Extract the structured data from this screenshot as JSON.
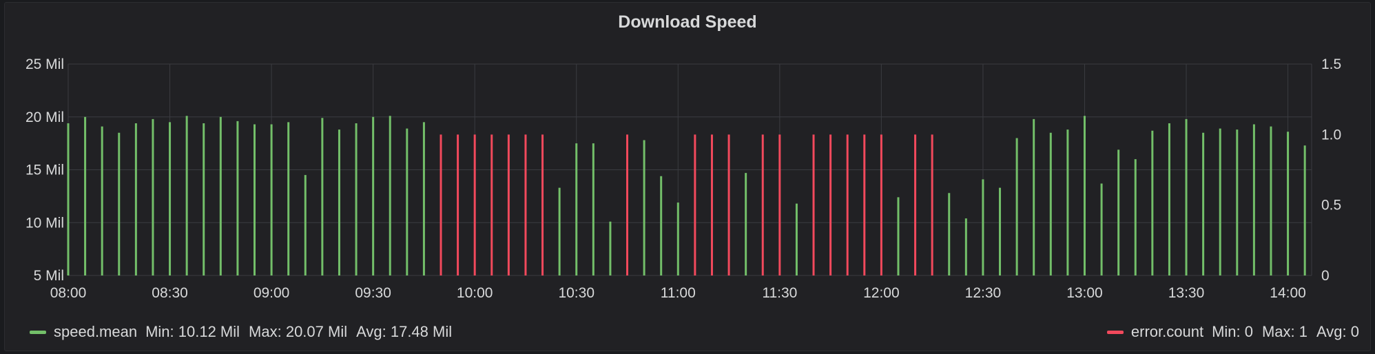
{
  "panel": {
    "title": "Download Speed"
  },
  "chart_data": {
    "type": "bar",
    "title": "Download Speed",
    "x_range": [
      "08:00",
      "14:07"
    ],
    "x_ticks": [
      "08:00",
      "08:30",
      "09:00",
      "09:30",
      "10:00",
      "10:30",
      "11:00",
      "11:30",
      "12:00",
      "12:30",
      "13:00",
      "13:30",
      "14:00"
    ],
    "y_left": {
      "min": 5,
      "max": 25,
      "unit": "Mil",
      "ticks": [
        "5 Mil",
        "10 Mil",
        "15 Mil",
        "20 Mil",
        "25 Mil"
      ]
    },
    "y_right": {
      "min": 0,
      "max": 1.5,
      "ticks": [
        "0",
        "0.5",
        "1.0",
        "1.5"
      ]
    },
    "grid": true,
    "legend_placement": "bottom",
    "series": [
      {
        "name": "speed.mean",
        "axis": "left",
        "color": "#73bf69",
        "points": [
          [
            "08:00",
            19.4
          ],
          [
            "08:05",
            20.0
          ],
          [
            "08:10",
            19.1
          ],
          [
            "08:15",
            18.5
          ],
          [
            "08:20",
            19.4
          ],
          [
            "08:25",
            19.8
          ],
          [
            "08:30",
            19.5
          ],
          [
            "08:35",
            20.1
          ],
          [
            "08:40",
            19.4
          ],
          [
            "08:45",
            20.0
          ],
          [
            "08:50",
            19.6
          ],
          [
            "08:55",
            19.3
          ],
          [
            "09:00",
            19.3
          ],
          [
            "09:05",
            19.5
          ],
          [
            "09:10",
            14.5
          ],
          [
            "09:15",
            19.9
          ],
          [
            "09:20",
            18.8
          ],
          [
            "09:25",
            19.4
          ],
          [
            "09:30",
            20.0
          ],
          [
            "09:35",
            20.1
          ],
          [
            "09:40",
            18.9
          ],
          [
            "09:45",
            19.5
          ],
          [
            "10:25",
            13.3
          ],
          [
            "10:30",
            17.5
          ],
          [
            "10:35",
            17.5
          ],
          [
            "10:40",
            10.1
          ],
          [
            "10:50",
            17.8
          ],
          [
            "10:55",
            14.4
          ],
          [
            "11:00",
            11.9
          ],
          [
            "11:20",
            14.7
          ],
          [
            "11:35",
            11.8
          ],
          [
            "12:05",
            12.4
          ],
          [
            "12:20",
            12.8
          ],
          [
            "12:25",
            10.4
          ],
          [
            "12:30",
            14.1
          ],
          [
            "12:35",
            13.3
          ],
          [
            "12:40",
            18.0
          ],
          [
            "12:45",
            19.8
          ],
          [
            "12:50",
            18.5
          ],
          [
            "12:55",
            18.8
          ],
          [
            "13:00",
            20.1
          ],
          [
            "13:05",
            13.7
          ],
          [
            "13:10",
            16.9
          ],
          [
            "13:15",
            16.0
          ],
          [
            "13:20",
            18.7
          ],
          [
            "13:25",
            19.4
          ],
          [
            "13:30",
            19.8
          ],
          [
            "13:35",
            18.5
          ],
          [
            "13:40",
            18.9
          ],
          [
            "13:45",
            18.8
          ],
          [
            "13:50",
            19.3
          ],
          [
            "13:55",
            19.1
          ],
          [
            "14:00",
            18.6
          ],
          [
            "14:05",
            17.3
          ]
        ]
      },
      {
        "name": "error.count",
        "axis": "right",
        "color": "#f2495c",
        "points": [
          [
            "09:50",
            1
          ],
          [
            "09:55",
            1
          ],
          [
            "10:00",
            1
          ],
          [
            "10:05",
            1
          ],
          [
            "10:10",
            1
          ],
          [
            "10:15",
            1
          ],
          [
            "10:20",
            1
          ],
          [
            "10:45",
            1
          ],
          [
            "11:05",
            1
          ],
          [
            "11:10",
            1
          ],
          [
            "11:15",
            1
          ],
          [
            "11:25",
            1
          ],
          [
            "11:30",
            1
          ],
          [
            "11:40",
            1
          ],
          [
            "11:45",
            1
          ],
          [
            "11:50",
            1
          ],
          [
            "11:55",
            1
          ],
          [
            "12:00",
            1
          ],
          [
            "12:10",
            1
          ],
          [
            "12:15",
            1
          ]
        ]
      }
    ]
  },
  "legend": {
    "left": {
      "name": "speed.mean",
      "min": "Min: 10.12 Mil",
      "max": "Max: 20.07 Mil",
      "avg": "Avg: 17.48 Mil",
      "color": "#73bf69"
    },
    "right": {
      "name": "error.count",
      "min": "Min: 0",
      "max": "Max: 1",
      "avg": "Avg: 0",
      "color": "#f2495c"
    }
  }
}
